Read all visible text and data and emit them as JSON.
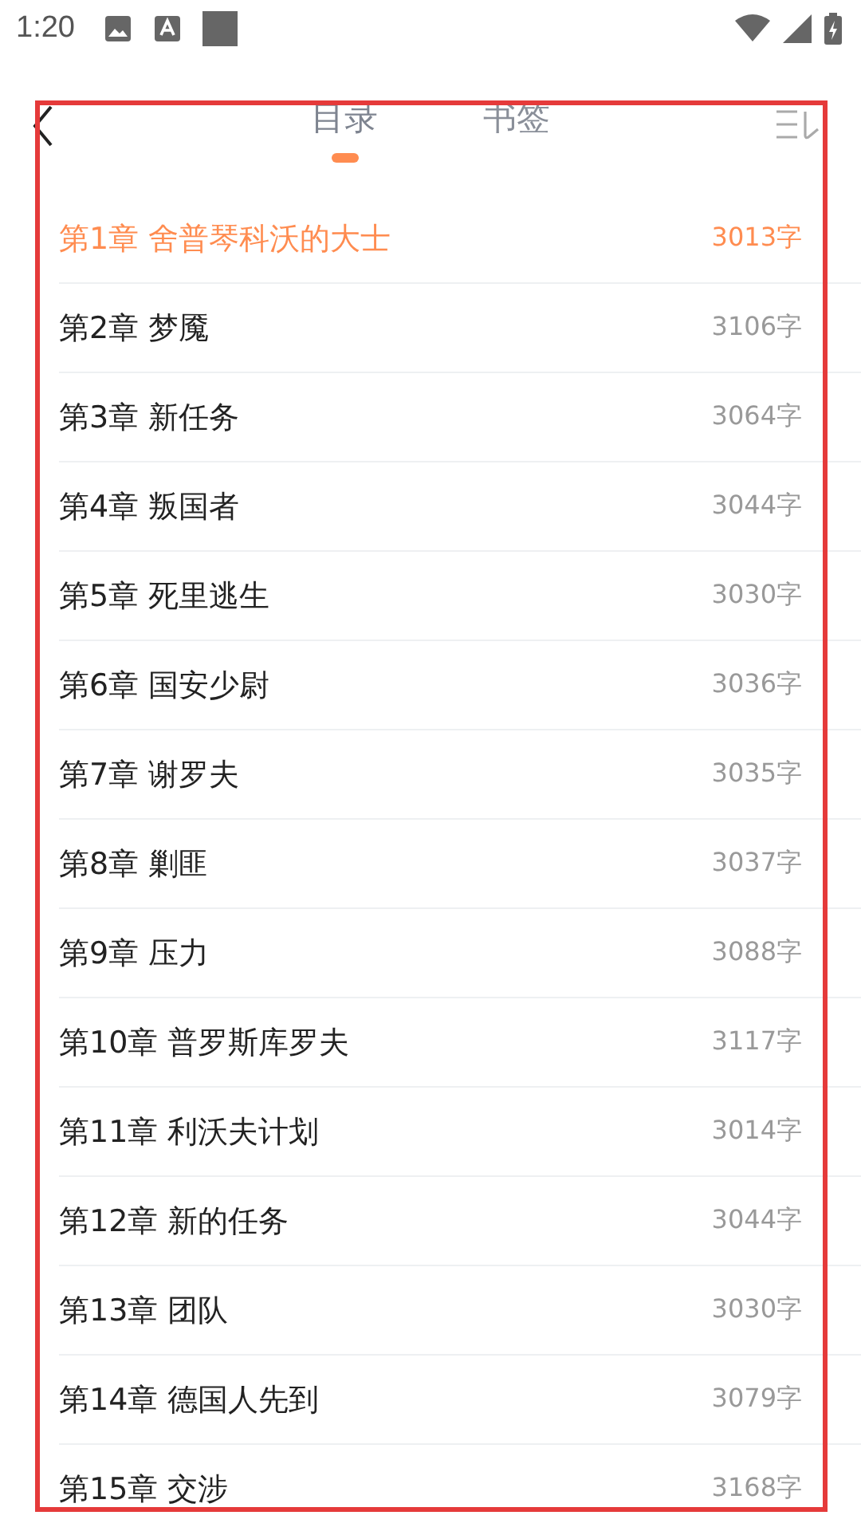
{
  "status_bar": {
    "time": "1:20"
  },
  "tabs": [
    {
      "label": "目录",
      "selected": true
    },
    {
      "label": "书签",
      "selected": false
    }
  ],
  "chapters": [
    {
      "title": "第1章 舍普琴科沃的大士",
      "words": "3013字",
      "selected": true
    },
    {
      "title": "第2章 梦魇",
      "words": "3106字",
      "selected": false
    },
    {
      "title": "第3章 新任务",
      "words": "3064字",
      "selected": false
    },
    {
      "title": "第4章 叛国者",
      "words": "3044字",
      "selected": false
    },
    {
      "title": "第5章 死里逃生",
      "words": "3030字",
      "selected": false
    },
    {
      "title": "第6章 国安少尉",
      "words": "3036字",
      "selected": false
    },
    {
      "title": "第7章 谢罗夫",
      "words": "3035字",
      "selected": false
    },
    {
      "title": "第8章 剿匪",
      "words": "3037字",
      "selected": false
    },
    {
      "title": "第9章 压力",
      "words": "3088字",
      "selected": false
    },
    {
      "title": "第10章 普罗斯库罗夫",
      "words": "3117字",
      "selected": false
    },
    {
      "title": "第11章 利沃夫计划",
      "words": "3014字",
      "selected": false
    },
    {
      "title": "第12章 新的任务",
      "words": "3044字",
      "selected": false
    },
    {
      "title": "第13章 团队",
      "words": "3030字",
      "selected": false
    },
    {
      "title": "第14章 德国人先到",
      "words": "3079字",
      "selected": false
    },
    {
      "title": "第15章 交涉",
      "words": "3168字",
      "selected": false
    }
  ]
}
